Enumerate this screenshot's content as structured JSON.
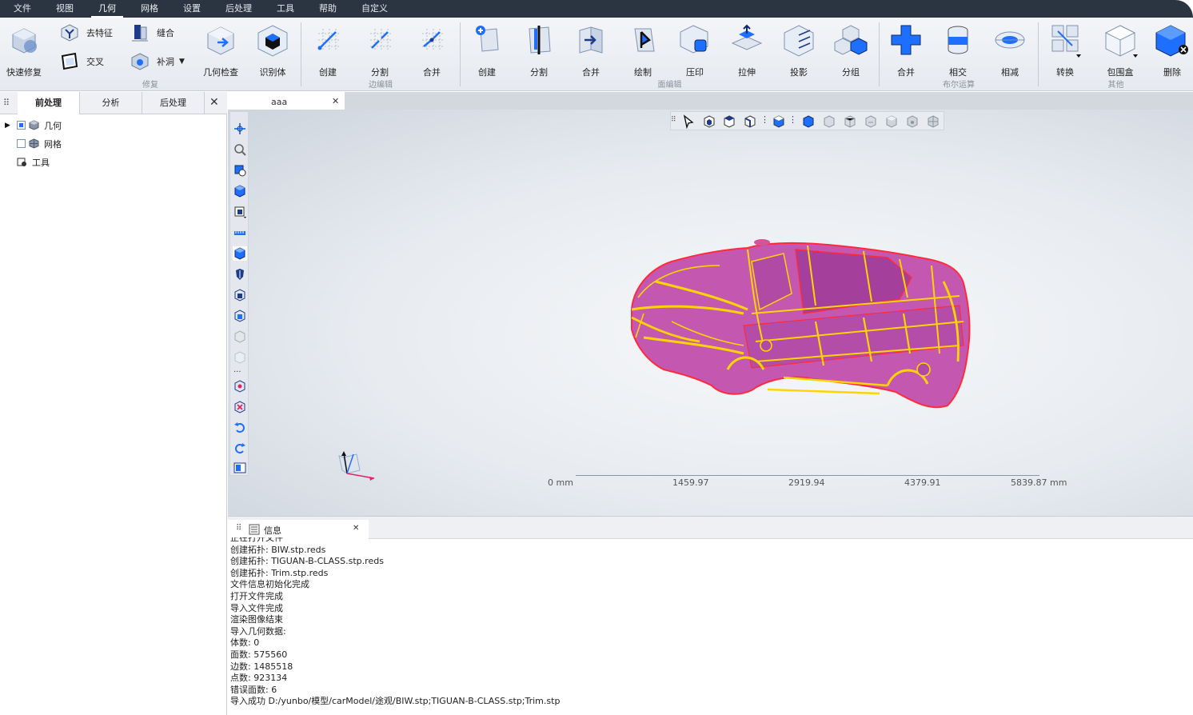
{
  "menubar": {
    "items": [
      "文件",
      "视图",
      "几何",
      "网格",
      "设置",
      "后处理",
      "工具",
      "帮助",
      "自定义"
    ],
    "active_index": 2
  },
  "ribbon": {
    "repair": {
      "label": "修复",
      "quick_repair": "快速修复",
      "defeature": "去特征",
      "intersect": "交叉",
      "stitch": "缝合",
      "patch": "补洞",
      "geo_check": "几何检查",
      "recognize": "识别体"
    },
    "edge_edit": {
      "label": "边编辑",
      "create": "创建",
      "split": "分割",
      "merge": "合并"
    },
    "face_edit": {
      "label": "面编辑",
      "create": "创建",
      "split": "分割",
      "merge": "合并",
      "draw": "绘制",
      "imprint": "压印",
      "extrude": "拉伸",
      "project": "投影",
      "group": "分组"
    },
    "boolean": {
      "label": "布尔运算",
      "union": "合并",
      "intersect": "相交",
      "subtract": "相减"
    },
    "other": {
      "label": "其他",
      "convert": "转换",
      "bbox": "包围盒",
      "delete": "删除"
    }
  },
  "left_panel": {
    "tabs": [
      "前处理",
      "分析",
      "后处理"
    ],
    "tree": [
      {
        "label": "几何"
      },
      {
        "label": "网格"
      },
      {
        "label": "工具"
      }
    ]
  },
  "document_tab": {
    "label": "aaa"
  },
  "scale_bar": {
    "labels": [
      "0 mm",
      "1459.97",
      "2919.94",
      "4379.91",
      "5839.87 mm"
    ]
  },
  "info_panel": {
    "title": "信息",
    "lines": [
      "正在打开文件",
      "创建拓扑: BIW.stp.reds",
      "创建拓扑: TIGUAN-B-CLASS.stp.reds",
      "创建拓扑: Trim.stp.reds",
      "文件信息初始化完成",
      "打开文件完成",
      "导入文件完成",
      "渲染图像结束",
      "导入几何数据:",
      "体数: 0",
      "面数: 575560",
      "边数: 1485518",
      "点数: 923134",
      "错误面数: 6",
      "导入成功 D:/yunbo/模型/carModel/途观/BIW.stp;TIGUAN-B-CLASS.stp;Trim.stp"
    ]
  },
  "colors": {
    "menubar_bg": "#2b3542",
    "car_body": "#c458b0",
    "car_edges": "#ffd400",
    "accent_blue": "#1e6fff"
  }
}
